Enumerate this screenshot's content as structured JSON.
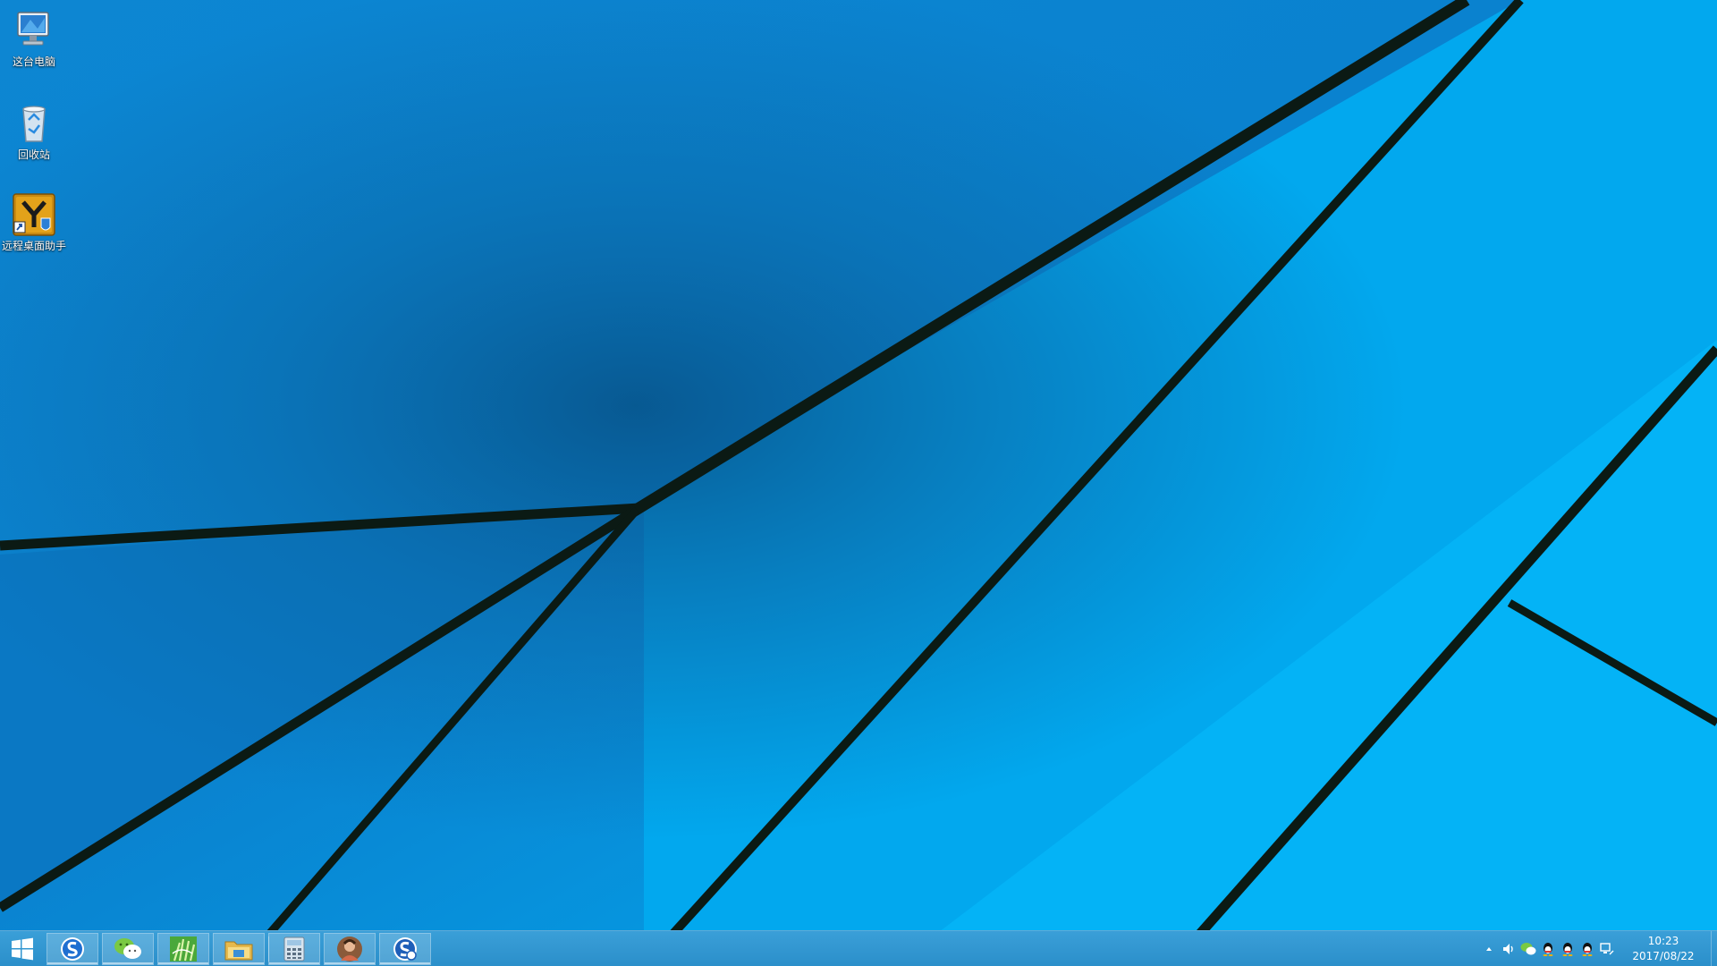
{
  "desktop": {
    "icons": [
      {
        "label": "这台电脑",
        "icon": "computer-icon"
      },
      {
        "label": "回收站",
        "icon": "recycle-bin-icon"
      },
      {
        "label": "远程桌面助手",
        "icon": "remote-desktop-assistant-icon"
      }
    ]
  },
  "taskbar": {
    "start_icon": "windows-logo-icon",
    "apps": [
      {
        "icon": "sogou-browser-icon"
      },
      {
        "icon": "wechat-icon"
      },
      {
        "icon": "green-app-icon"
      },
      {
        "icon": "file-explorer-icon"
      },
      {
        "icon": "calculator-icon"
      },
      {
        "icon": "avatar-app-icon"
      },
      {
        "icon": "sogou-input-icon"
      }
    ],
    "tray": {
      "icons": [
        "show-hidden-icons-chevron",
        "volume-icon",
        "wechat-tray-icon",
        "qq-icon",
        "qq-icon",
        "qq-icon",
        "network-icon"
      ],
      "time": "10:23",
      "date": "2017/08/22"
    }
  },
  "colors": {
    "wallpaper_base": "#049be4",
    "wallpaper_dark": "#0a5fa0",
    "taskbar": "#2b8fca",
    "line": "#0b1a14"
  }
}
